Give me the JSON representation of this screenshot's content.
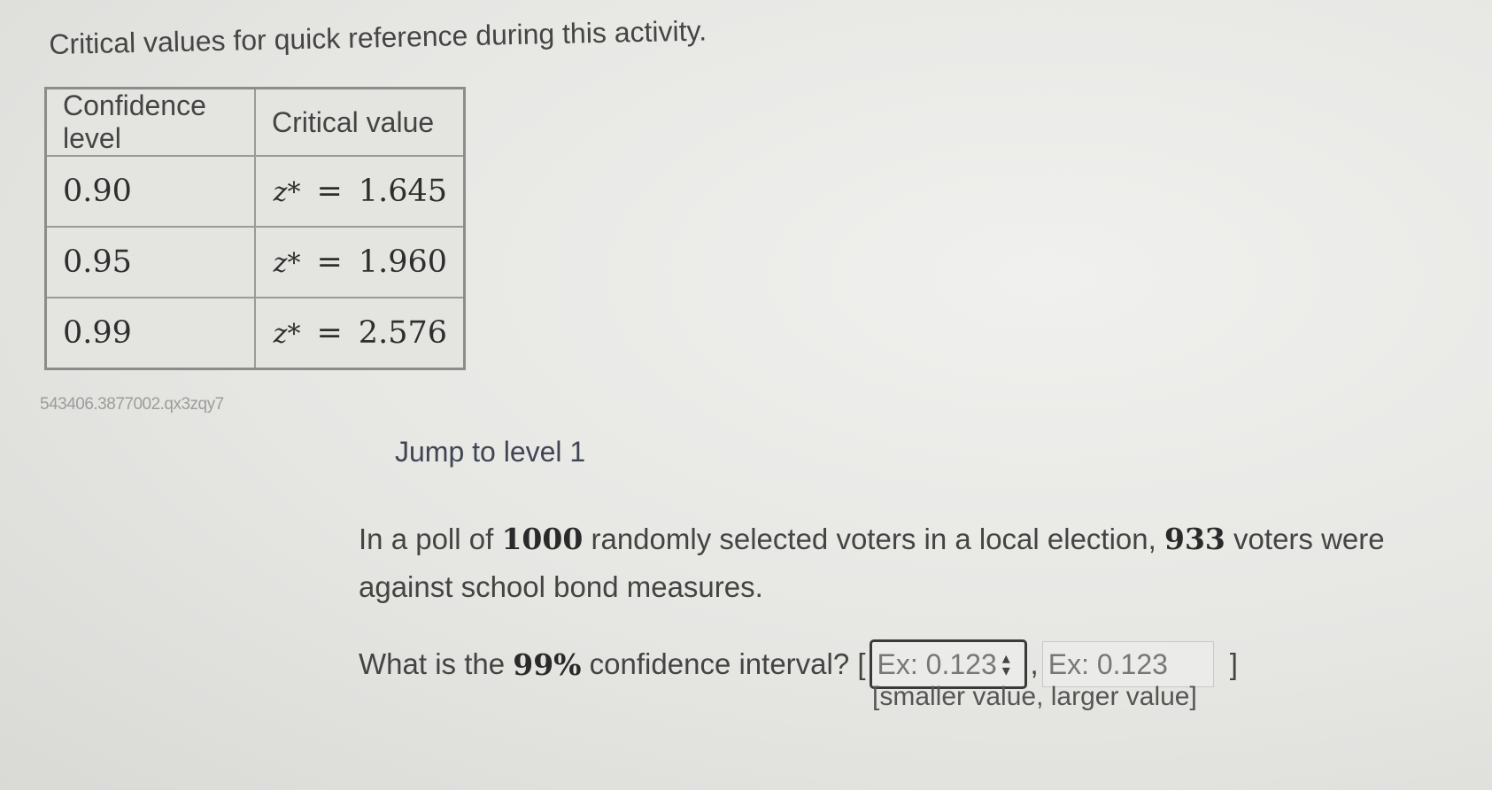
{
  "intro": "Critical values for quick reference during this activity.",
  "table": {
    "headers": [
      "Confidence level",
      "Critical value"
    ],
    "rows": [
      {
        "level": "0.90",
        "var": "z*",
        "eq": "=",
        "value": "1.645"
      },
      {
        "level": "0.95",
        "var": "z*",
        "eq": "=",
        "value": "1.960"
      },
      {
        "level": "0.99",
        "var": "z*",
        "eq": "=",
        "value": "2.576"
      }
    ]
  },
  "code": "543406.3877002.qx3zqy7",
  "jump": "Jump to level 1",
  "problem": {
    "p1": "In a poll of ",
    "n1": "1000",
    "p2": " randomly selected voters in a local election, ",
    "n2": "933",
    "p3": " voters were against school bond measures."
  },
  "question": {
    "before": "What is the ",
    "pct": "99%",
    "after": " confidence interval? [",
    "comma": ",",
    "close": "]",
    "input1_placeholder": "Ex: 0.123",
    "input2_placeholder": "Ex: 0.123",
    "hint": "[smaller value, larger value]"
  }
}
